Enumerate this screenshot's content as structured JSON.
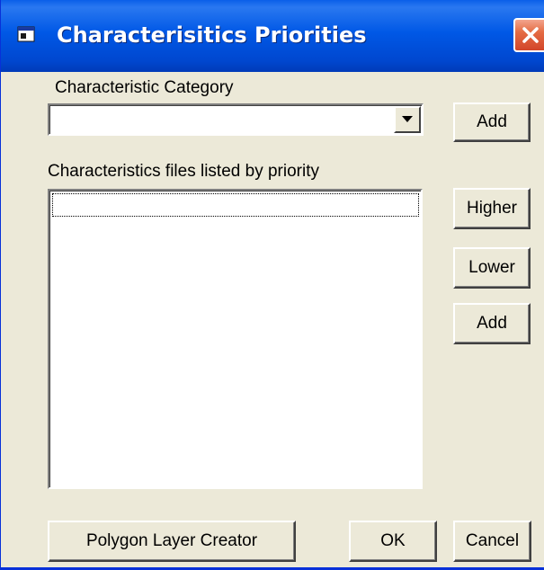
{
  "window": {
    "title": "Characterisitics Priorities"
  },
  "category": {
    "label": "Characteristic Category",
    "value": "",
    "add_label": "Add"
  },
  "priority_list": {
    "label": "Characteristics files listed by priority",
    "items": []
  },
  "side_buttons": {
    "higher_label": "Higher",
    "lower_label": "Lower",
    "add_label": "Add"
  },
  "footer": {
    "polygon_label": "Polygon Layer Creator",
    "ok_label": "OK",
    "cancel_label": "Cancel"
  },
  "colors": {
    "title_bar": "#0058e6",
    "dialog_face": "#ece9d8",
    "close_button": "#e56c44"
  },
  "icons": {
    "title": "window-app-icon",
    "close": "close-icon",
    "dropdown": "chevron-down-icon"
  }
}
